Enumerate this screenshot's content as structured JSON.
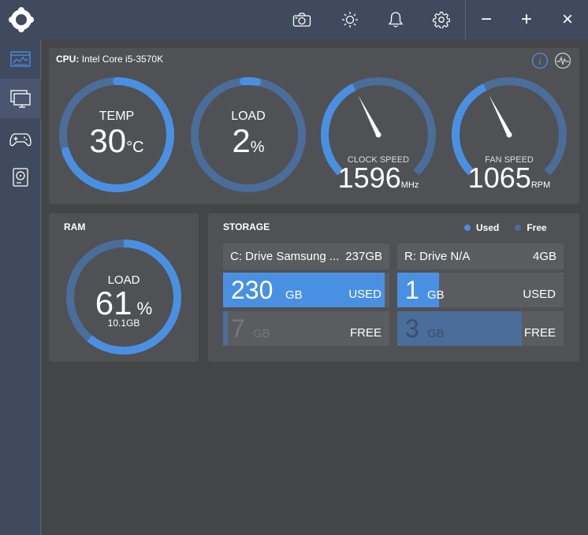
{
  "cpu": {
    "title_bold": "CPU:",
    "title_name": "Intel Core i5-3570K",
    "temp": {
      "label": "TEMP",
      "value": "30",
      "unit": "°C",
      "level": 0.7
    },
    "load": {
      "label": "LOAD",
      "value": "2",
      "unit": "%",
      "level": 0.02
    },
    "clock": {
      "label": "CLOCK SPEED",
      "value": "1596",
      "unit": "MHz",
      "level": 0.4
    },
    "fan": {
      "label": "FAN SPEED",
      "value": "1065",
      "unit": "RPM",
      "level": 0.4
    }
  },
  "ram": {
    "title": "RAM",
    "label": "LOAD",
    "value": "61",
    "unit": "%",
    "sub": "10.1GB",
    "level": 0.61
  },
  "storage": {
    "title": "STORAGE",
    "legend_used": "Used",
    "legend_free": "Free",
    "drives": [
      {
        "name": "C: Drive Samsung ...",
        "size": "237GB",
        "used": "230",
        "free": "7",
        "unit": "GB",
        "used_tag": "USED",
        "free_tag": "FREE",
        "used_fraction": 0.97,
        "free_fraction": 0.03
      },
      {
        "name": "R: Drive N/A",
        "size": "4GB",
        "used": "1",
        "free": "3",
        "unit": "GB",
        "used_tag": "USED",
        "free_tag": "FREE",
        "used_fraction": 0.25,
        "free_fraction": 0.75
      }
    ]
  },
  "icons": {
    "logo": "app-logo-icon",
    "camera": "camera-icon",
    "brightness": "brightness-icon",
    "bell": "bell-icon",
    "settings": "gear-icon",
    "minimize": "−",
    "maximize": "+",
    "close": "×"
  },
  "colors": {
    "accent": "#4a90e2",
    "track": "#4b6d9a",
    "free_fill": "#4b6d9a",
    "sidebar": "#3f4a5e",
    "panel": "#505154",
    "background": "#444547"
  }
}
